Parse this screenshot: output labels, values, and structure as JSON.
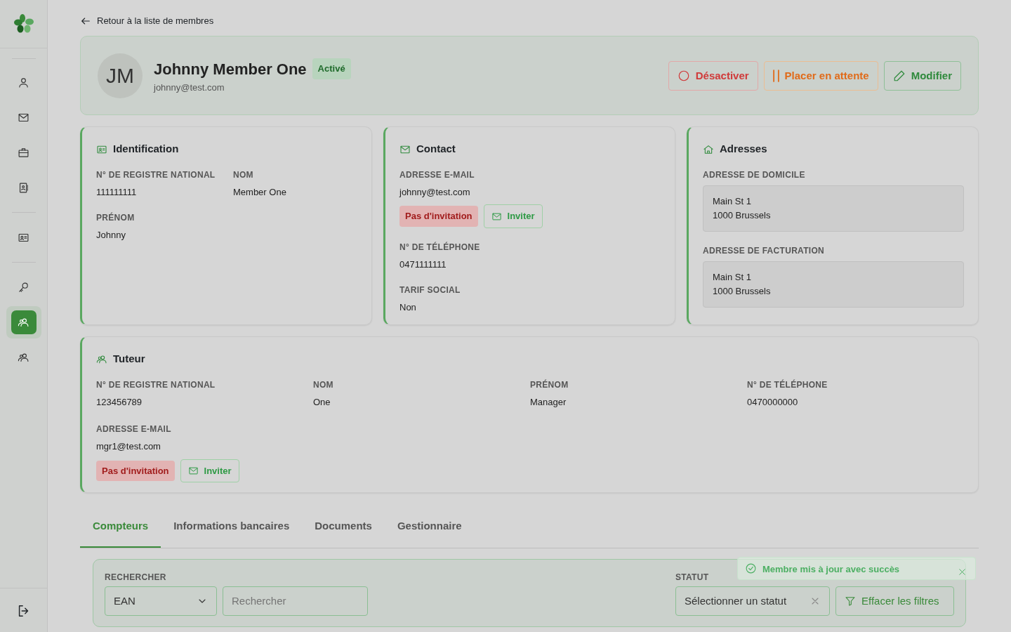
{
  "sidebar": {
    "items": [
      {
        "selected": false
      },
      {
        "selected": false
      },
      {
        "selected": false
      },
      {
        "selected": false
      },
      {
        "selected": false
      },
      {
        "selected": false
      },
      {
        "selected": true
      },
      {
        "selected": false
      }
    ]
  },
  "back_link": "Retour à la liste de membres",
  "member": {
    "initials": "JM",
    "name": "Johnny Member One",
    "status": "Activé",
    "email": "johnny@test.com"
  },
  "actions": [
    {
      "kind": "deactivate",
      "label": "Désactiver"
    },
    {
      "kind": "hold",
      "label": "Placer en attente"
    },
    {
      "kind": "edit",
      "label": "Modifier"
    }
  ],
  "cards": [
    {
      "kind": "id",
      "title": "Identification",
      "fields": [
        {
          "label": "N° DE REGISTRE NATIONAL",
          "value": "111111111"
        },
        {
          "label": "NOM",
          "value": "Member One"
        },
        {
          "label": "PRÉNOM",
          "value": "Johnny"
        }
      ]
    },
    {
      "kind": "contact",
      "title": "Contact",
      "fields": [
        {
          "label": "ADRESSE E-MAIL",
          "value": "johnny@test.com",
          "invitation": {
            "status": "Pas d'invitation",
            "button": "Inviter"
          }
        },
        {
          "label": "N° DE TÉLÉPHONE",
          "value": "0471111111"
        },
        {
          "label": "TARIF SOCIAL",
          "value": "Non"
        }
      ]
    },
    {
      "kind": "address",
      "title": "Adresses",
      "addresses": [
        {
          "label": "ADRESSE DE DOMICILE",
          "lines": [
            "Main St 1",
            "1000 Brussels"
          ]
        },
        {
          "label": "ADRESSE DE FACTURATION",
          "lines": [
            "Main St 1",
            "1000 Brussels"
          ]
        }
      ]
    }
  ],
  "guardian": {
    "title": "Tuteur",
    "fields": [
      {
        "label": "N° DE REGISTRE NATIONAL",
        "value": "123456789"
      },
      {
        "label": "NOM",
        "value": "One"
      },
      {
        "label": "PRÉNOM",
        "value": "Manager"
      },
      {
        "label": "N° DE TÉLÉPHONE",
        "value": "0470000000"
      },
      {
        "label": "ADRESSE E-MAIL",
        "value": "mgr1@test.com",
        "invitation": {
          "status": "Pas d'invitation",
          "button": "Inviter"
        }
      }
    ]
  },
  "tabs": [
    {
      "label": "Compteurs",
      "selected": true
    },
    {
      "label": "Informations bancaires",
      "selected": false
    },
    {
      "label": "Documents",
      "selected": false
    },
    {
      "label": "Gestionnaire",
      "selected": false
    }
  ],
  "filters": {
    "search_label": "RECHERCHER",
    "search_type": "EAN",
    "search_placeholder": "Rechercher",
    "status_label": "STATUT",
    "status_placeholder": "Sélectionner un statut",
    "clear": "Effacer les filtres"
  },
  "toast": {
    "message": "Membre mis à jour avec succès"
  }
}
